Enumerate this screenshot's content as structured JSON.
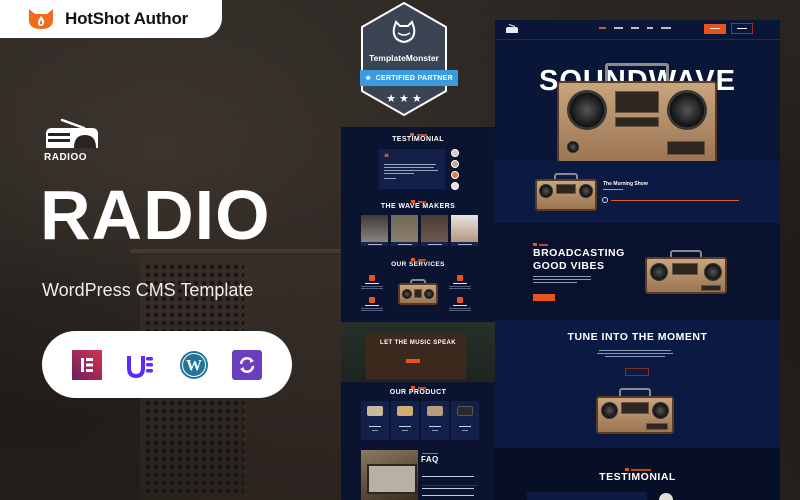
{
  "brand": {
    "name": "HotShot Author",
    "logo_icon": "fox-flame-icon",
    "accent": "#f26b1d"
  },
  "promo": {
    "logo_text": "RADIOO",
    "logo_icon": "radio-icon",
    "title": "RADIO",
    "subtitle": "WordPress CMS Template",
    "plugins": [
      {
        "name": "Elementor",
        "icon": "elementor-icon",
        "color": "#92003b"
      },
      {
        "name": "Unlimited Elements",
        "icon": "unlimited-elements-icon",
        "color": "#5b2bff"
      },
      {
        "name": "WordPress",
        "icon": "wordpress-icon",
        "color": "#21759b"
      },
      {
        "name": "Updraft / Sync",
        "icon": "refresh-icon",
        "color": "#6a3fbf"
      }
    ]
  },
  "badge": {
    "brand": "TemplateMonster",
    "ribbon": "CERTIFIED PARTNER",
    "ribbon_star": "★",
    "stars": "★ ★ ★",
    "ribbon_color": "#3a9be0",
    "frame_color": "#3b4452"
  },
  "preview_mid": {
    "testimonial_title": "TESTIMONIAL",
    "team_title": "THE WAVE MAKERS",
    "team_photo_colors": [
      "#7a736c",
      "#8d7e6c",
      "#6c5a4d",
      "#d9d3cf"
    ],
    "services_title": "OUR SERVICES",
    "music_title": "LET THE MUSIC SPEAK",
    "product_title": "OUR PRODUCT",
    "product_image_colors": [
      "#c9b89e",
      "#d2ac73",
      "#b69d80",
      "#2a2a2a"
    ],
    "faq_title": "FAQ",
    "quote_mark": "❝",
    "avatar_colors": [
      "#d8c8bc",
      "#c9a78c",
      "#e07d3c",
      "#eadfd6"
    ]
  },
  "preview_right": {
    "hero_title": "SOUNDWAVE",
    "show_title": "The Morning Show",
    "show_progress": 1.0,
    "about_title_line1": "BROADCASTING",
    "about_title_line2": "GOOD VIBES",
    "tune_title": "TUNE INTO THE MOMENT",
    "testimonial_title": "TESTIMONIAL",
    "accent": "#e8531e",
    "background": "#0a1637"
  }
}
